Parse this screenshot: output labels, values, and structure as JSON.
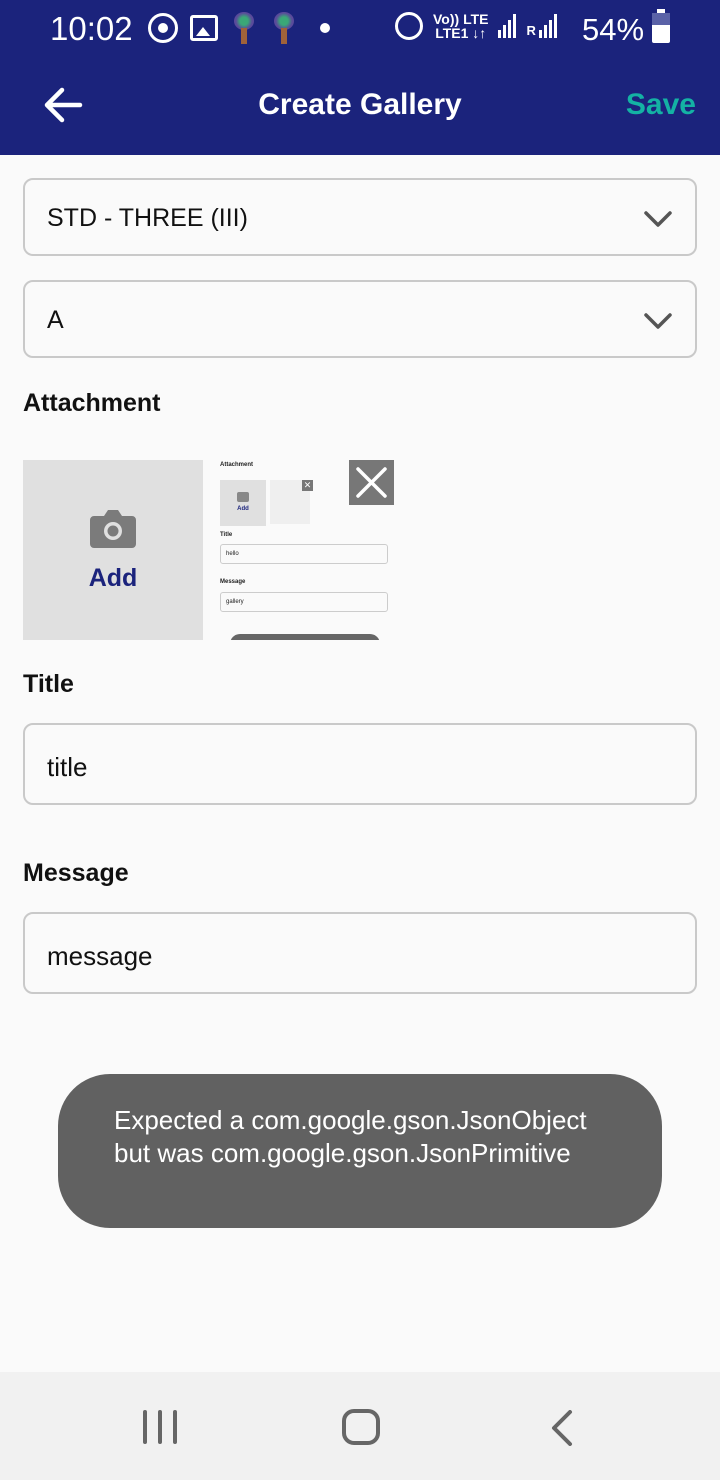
{
  "status_bar": {
    "time": "10:02",
    "battery_percent": "54%",
    "network_top": "Vo)) LTE",
    "network_bottom": "LTE1 ↓↑",
    "roaming": "R"
  },
  "app_bar": {
    "title": "Create Gallery",
    "save_label": "Save"
  },
  "form": {
    "class_select": {
      "value": "STD - THREE (III)"
    },
    "section_select": {
      "value": "A"
    },
    "attachment_label": "Attachment",
    "add_label": "Add",
    "title_label": "Title",
    "title_value": "title",
    "message_label": "Message",
    "message_value": "message"
  },
  "attachment_thumbnail": {
    "attachment_label": "Attachment",
    "add_label": "Add",
    "title_label": "Title",
    "title_value": "hello",
    "message_label": "Message",
    "message_value": "gallery"
  },
  "toast": {
    "message": "Expected a com.google.gson.JsonObject but was com.google.gson.JsonPrimitive"
  },
  "colors": {
    "app_bar": "#1b237c",
    "save": "#14b2a4",
    "add_text": "#1b237c",
    "toast_bg": "#616161"
  },
  "icons": [
    "back-arrow-icon",
    "chevron-down-icon",
    "camera-icon",
    "close-icon",
    "whatsapp-icon",
    "gallery-icon",
    "alarm-icon",
    "signal-icon",
    "battery-icon"
  ]
}
